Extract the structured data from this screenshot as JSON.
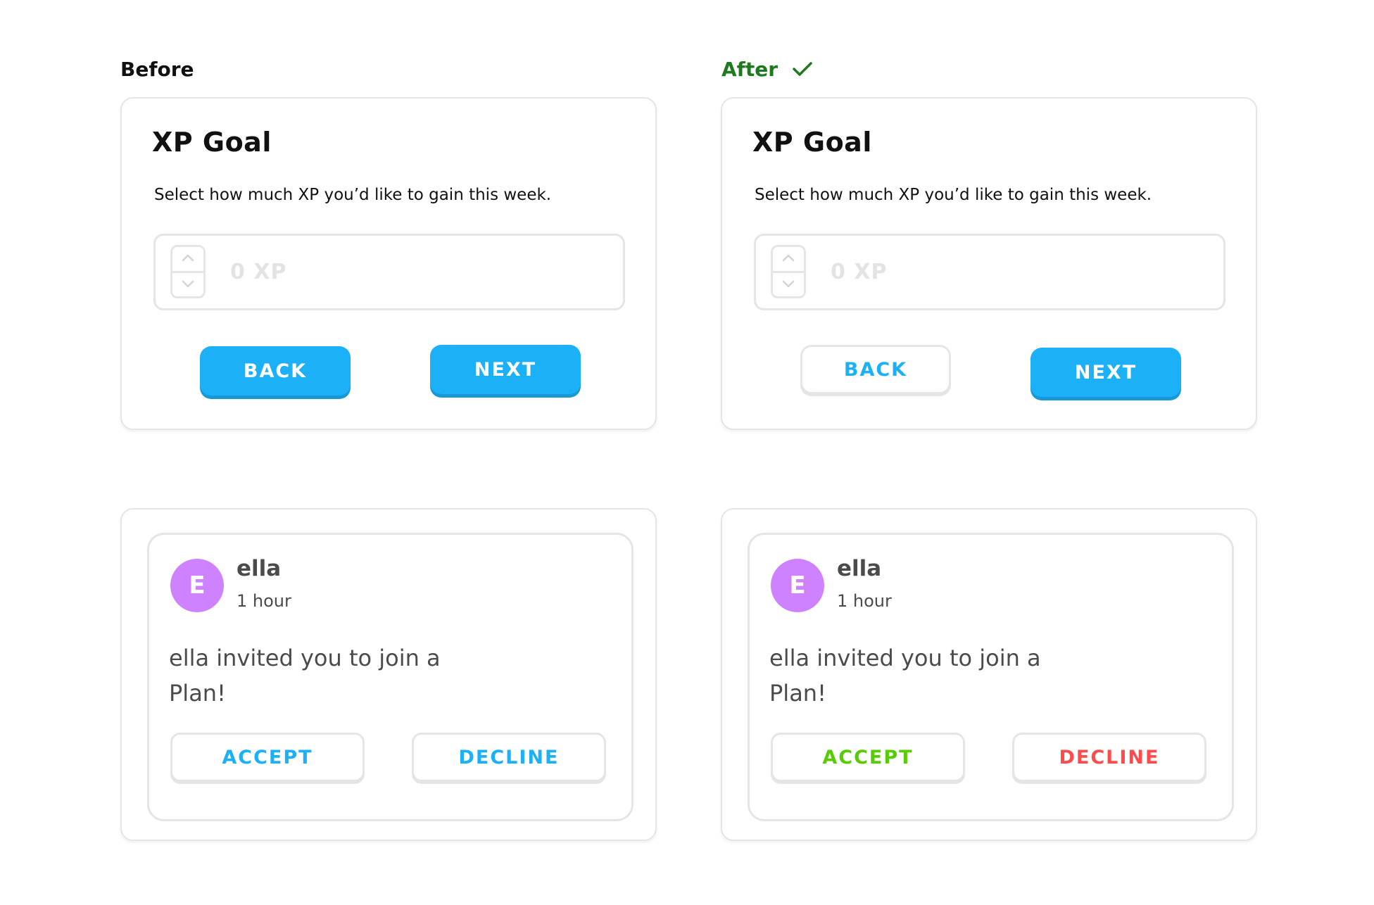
{
  "labels": {
    "before": "Before",
    "after": "After"
  },
  "icons": {
    "after_check": "check-icon",
    "stepper_up": "chevron-up-icon",
    "stepper_down": "chevron-down-icon"
  },
  "colors": {
    "primary_blue": "#1cb0f6",
    "accept_green": "#58cc02",
    "decline_red": "#ff4b4b",
    "after_label_green": "#1f7a1f",
    "avatar_purple": "#ce82ff"
  },
  "xp_goal": {
    "title": "XP Goal",
    "description": "Select how much XP you’d like to gain this week.",
    "input_value": "0 XP",
    "back_label": "BACK",
    "next_label": "NEXT"
  },
  "invite": {
    "avatar_initial": "E",
    "user_name": "ella",
    "time": "1 hour",
    "message": "ella invited you to join a Plan!",
    "accept_label": "ACCEPT",
    "decline_label": "DECLINE"
  }
}
